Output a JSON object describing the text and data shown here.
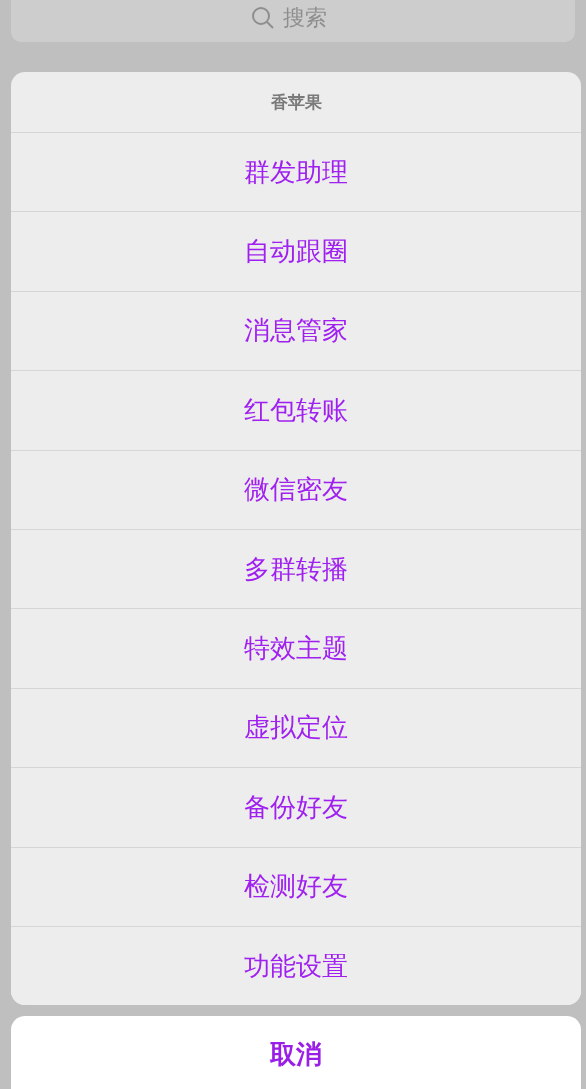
{
  "search": {
    "placeholder": "搜索"
  },
  "action_sheet": {
    "title": "香苹果",
    "items": [
      {
        "label": "群发助理"
      },
      {
        "label": "自动跟圈"
      },
      {
        "label": "消息管家"
      },
      {
        "label": "红包转账"
      },
      {
        "label": "微信密友"
      },
      {
        "label": "多群转播"
      },
      {
        "label": "特效主题"
      },
      {
        "label": "虚拟定位"
      },
      {
        "label": "备份好友"
      },
      {
        "label": "检测好友"
      },
      {
        "label": "功能设置"
      }
    ]
  },
  "cancel_button": "取消"
}
